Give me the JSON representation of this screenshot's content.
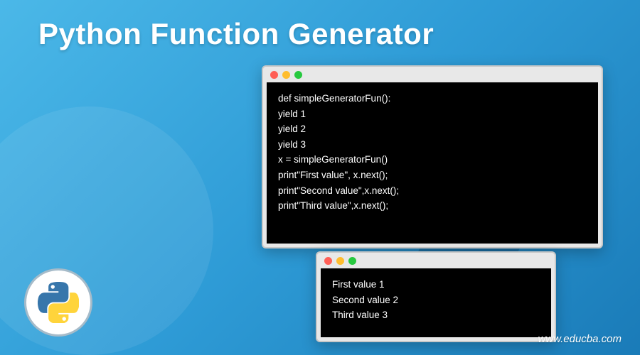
{
  "title": "Python Function Generator",
  "code_window": {
    "lines": "def simpleGeneratorFun():\nyield 1\nyield 2\nyield 3\nx = simpleGeneratorFun()\nprint\"First value\", x.next();\nprint\"Second value\",x.next();\nprint\"Third value\",x.next();"
  },
  "output_window": {
    "lines": "First value 1\nSecond value 2\nThird value 3"
  },
  "logo_alt": "python-logo",
  "site_url": "www.educba.com"
}
